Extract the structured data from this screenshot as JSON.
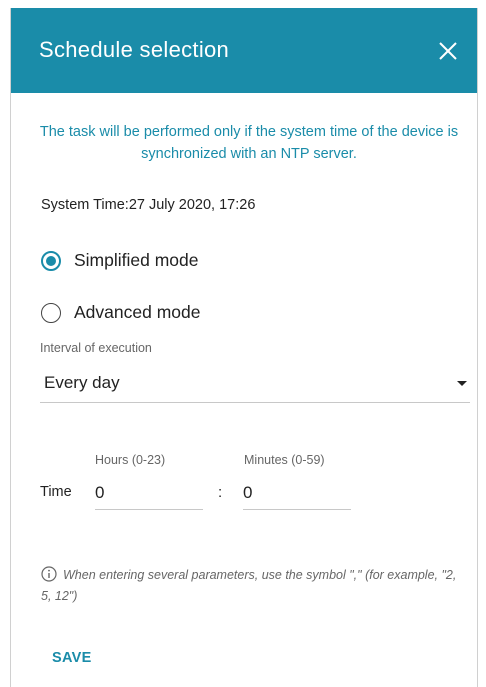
{
  "dialog": {
    "title": "Schedule selection",
    "close_icon": "close-icon"
  },
  "notice": "The task will be performed only if the system time of the device is synchronized with an NTP server.",
  "system_time": "System Time:27 July 2020, 17:26",
  "mode": {
    "options": [
      {
        "label": "Simplified mode",
        "selected": true
      },
      {
        "label": "Advanced mode",
        "selected": false
      }
    ]
  },
  "interval": {
    "label": "Interval of execution",
    "value": "Every day"
  },
  "time": {
    "label": "Time",
    "hours_label": "Hours (0-23)",
    "hours_value": "0",
    "minutes_label": "Minutes (0-59)",
    "minutes_value": "0",
    "separator": ":"
  },
  "hint": "When entering several parameters, use the symbol \",\" (for example, \"2, 5, 12\")",
  "save_label": "SAVE",
  "colors": {
    "accent": "#1a8ca9",
    "header_bg": "#1a8ca9"
  }
}
